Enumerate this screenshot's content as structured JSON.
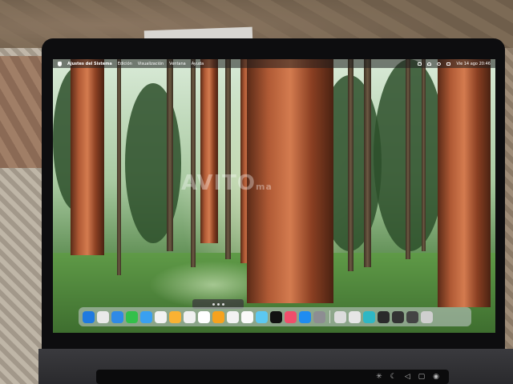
{
  "menubar": {
    "items": [
      "Ajustes del Sistema",
      "Edición",
      "Visualización",
      "Ventana",
      "Ayuda"
    ],
    "clock": "Vie 14 ago 20:46"
  },
  "watermark": {
    "text": "AVITO",
    "suffix": "ma"
  },
  "dock": {
    "app_colors": [
      "#1f7ae0",
      "#e9e9e9",
      "#2f8ae6",
      "#33c04a",
      "#3aa0f0",
      "#f2f2f2",
      "#f9b233",
      "#f0f0f0",
      "#ffffff",
      "#f6a21e",
      "#f2f2f2",
      "#fafafa",
      "#5cc8f0",
      "#111111",
      "#f04e6b",
      "#1f8cf0",
      "#8d8d92"
    ],
    "recent_colors": [
      "#dcdcdc",
      "#e6e6e6",
      "#2fb7c4",
      "#2a2a2a",
      "#333333",
      "#444444",
      "#cfcfcf"
    ]
  },
  "touchbar": {
    "icons": [
      "✳",
      "☾",
      "◁",
      "▢",
      "◉"
    ]
  }
}
